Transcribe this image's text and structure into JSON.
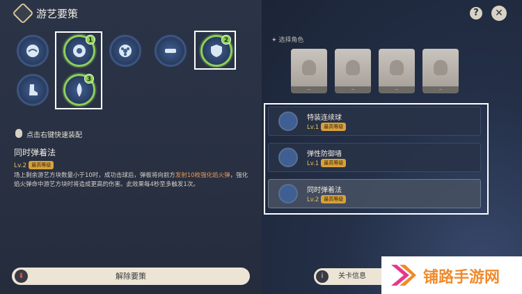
{
  "header": {
    "title": "游艺要策"
  },
  "controls": {
    "help": "?",
    "close": "✕"
  },
  "slots": [
    {
      "id": 1,
      "icon": "wave-icon"
    },
    {
      "id": 2,
      "icon": "ball-icon",
      "selected": true,
      "badge": "1"
    },
    {
      "id": 3,
      "icon": "flower-icon"
    },
    {
      "id": 4,
      "icon": "bar-icon"
    },
    {
      "id": 5,
      "icon": "shield-icon",
      "selected": true,
      "badge": "2"
    },
    {
      "id": 6,
      "icon": "boot-icon"
    },
    {
      "id": 7,
      "icon": "feather-icon",
      "selected": true,
      "badge": "3"
    }
  ],
  "hint": "点击右键快速装配",
  "skill": {
    "name": "同时弹着法",
    "level": "Lv.2",
    "badge": "最高等级",
    "desc_a": "场上剩余游艺方块数量小于10时，成功击球后，弹板将向前方",
    "desc_hl": "发射10枚强化焰火弹",
    "desc_b": "，强化焰火弹命中游艺方块时将造成更高的伤害。此效果每4秒至多触发1次。"
  },
  "buttons": {
    "remove": "解除要策",
    "stage": "关卡信息",
    "remove_icon": "⬇",
    "stage_icon": "i"
  },
  "roles": {
    "label": "选择角色",
    "cards": [
      "--",
      "--",
      "--",
      "--"
    ]
  },
  "equipped": [
    {
      "name": "特装连续球",
      "level": "Lv.1",
      "badge": "最高等级"
    },
    {
      "name": "弹性防御墙",
      "level": "Lv.1",
      "badge": "最高等级"
    },
    {
      "name": "同时弹着法",
      "level": "Lv.2",
      "badge": "最高等级"
    }
  ],
  "watermark": {
    "text": "铺路手游网"
  },
  "colors": {
    "accent_green": "#8ccf5a",
    "level_gold": "#e8c15c",
    "highlight": "#e89a55"
  }
}
